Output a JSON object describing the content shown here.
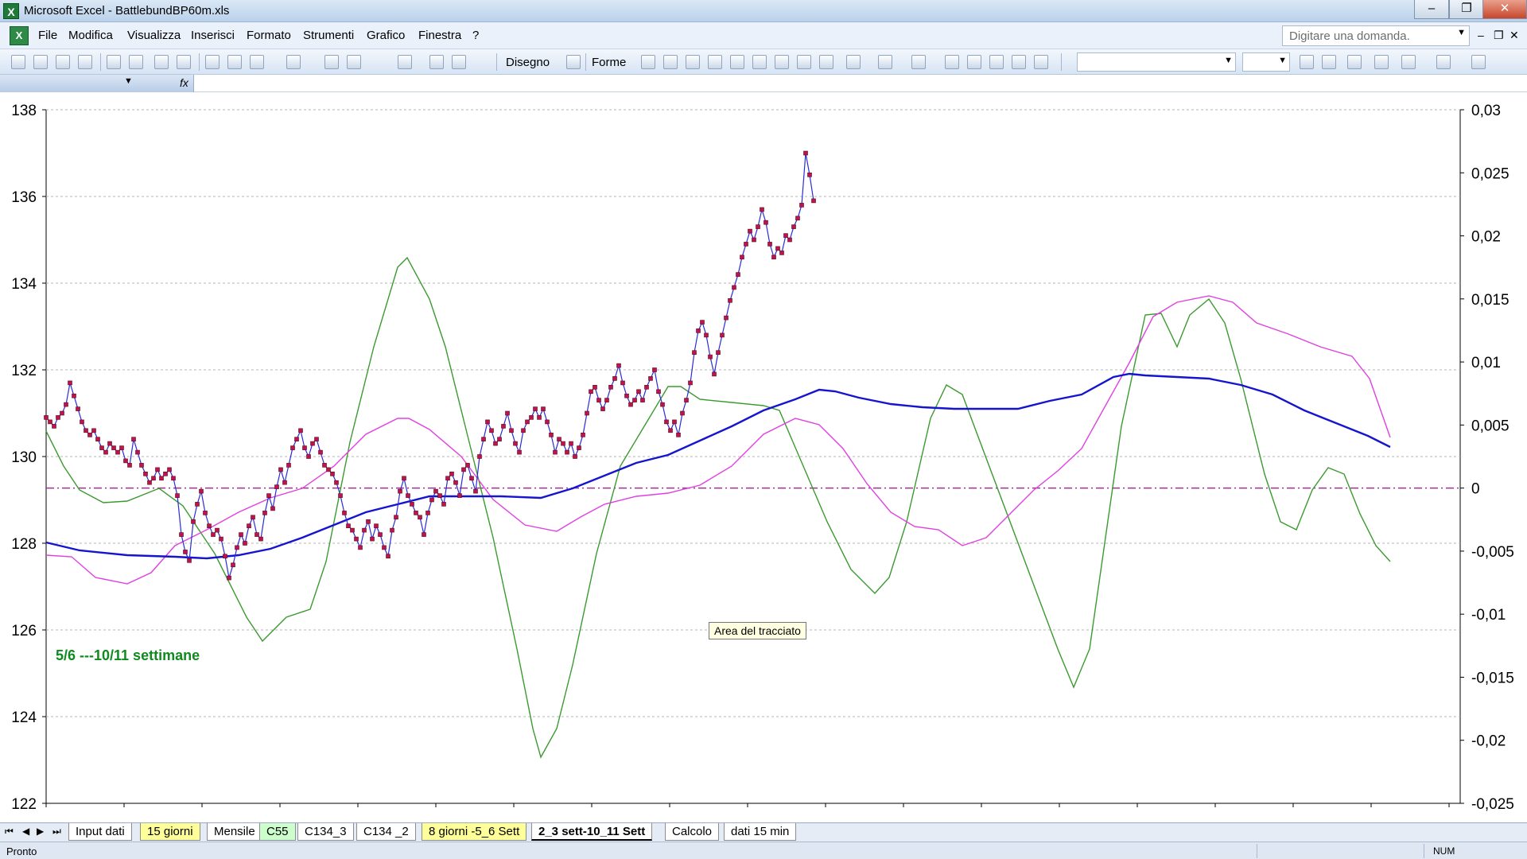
{
  "window": {
    "title": "Microsoft Excel - BattlebundBP60m.xls"
  },
  "menu": {
    "items": [
      "File",
      "Modifica",
      "Visualizza",
      "Inserisci",
      "Formato",
      "Strumenti",
      "Grafico",
      "Finestra",
      "?"
    ],
    "help_placeholder": "Digitare una domanda."
  },
  "toolbar": {
    "draw_label": "Disegno",
    "shapes_label": "Forme"
  },
  "chart": {
    "annotation": "5/6 ---10/11 settimane",
    "tooltip": "Area del tracciato"
  },
  "chart_data": {
    "type": "line",
    "left_axis": {
      "ylim": [
        122,
        138
      ],
      "ticks": [
        "122",
        "124",
        "126",
        "128",
        "130",
        "132",
        "134",
        "136",
        "138"
      ]
    },
    "right_axis": {
      "ylim": [
        -0.025,
        0.03
      ],
      "ticks": [
        "-0,025",
        "-0,02",
        "-0,015",
        "-0,01",
        "-0,005",
        "0",
        "0,005",
        "0,01",
        "0,015",
        "0,02",
        "0,025",
        "0,03"
      ]
    },
    "x": [
      0,
      5,
      10,
      15,
      20,
      25,
      30,
      35,
      40,
      45,
      50,
      55,
      60,
      65,
      70,
      75,
      80,
      85,
      90,
      95,
      100,
      105,
      110,
      115,
      120,
      125,
      130,
      135,
      140,
      145,
      150,
      155,
      160,
      165,
      170,
      175,
      180,
      185,
      190,
      195,
      200,
      205,
      210,
      215,
      220,
      225,
      230,
      235,
      240,
      245,
      250,
      255,
      260,
      265,
      270,
      275,
      280,
      285,
      290,
      295,
      300,
      305,
      310,
      315,
      320,
      325,
      330,
      335,
      340,
      345,
      350,
      355,
      360,
      365,
      370,
      375,
      380,
      385,
      390,
      395,
      400,
      405,
      410,
      415,
      420,
      425,
      430,
      435,
      440,
      445,
      450,
      455,
      460,
      465,
      470,
      475,
      480,
      485,
      490,
      495,
      500,
      505,
      510,
      515,
      520,
      525,
      530,
      535,
      540,
      545,
      550,
      555,
      560,
      565,
      570,
      575,
      580,
      585,
      590,
      595,
      600,
      605,
      610,
      615,
      620,
      625,
      630,
      635,
      640,
      645,
      650,
      655,
      660,
      665,
      670,
      675,
      680,
      685,
      690,
      695,
      700,
      705,
      710,
      715,
      720,
      725,
      730,
      735,
      740,
      745,
      750,
      755,
      760,
      765,
      770,
      775,
      780,
      785,
      790,
      795,
      800,
      805,
      810,
      815,
      820,
      825,
      830,
      835,
      840,
      845,
      850,
      855,
      860,
      865,
      870,
      875,
      880,
      885,
      890,
      895,
      900,
      905,
      910,
      915,
      920,
      925,
      930,
      935,
      940,
      945,
      950,
      955,
      960,
      965,
      970,
      975,
      980,
      985,
      990,
      995,
      1000,
      1005,
      1010,
      1015,
      1020,
      1025,
      1030,
      1035,
      1040,
      1045,
      1050,
      1055,
      1060,
      1065,
      1070,
      1075,
      1080,
      1085,
      1090,
      1095,
      1100,
      1105,
      1110,
      1115,
      1120,
      1125,
      1130,
      1135,
      1140,
      1145,
      1150,
      1155,
      1160,
      1165,
      1170,
      1175,
      1180,
      1185,
      1190,
      1195,
      1200,
      1205,
      1210,
      1215,
      1220,
      1225,
      1230,
      1235,
      1240,
      1245,
      1250,
      1255,
      1260,
      1265,
      1270,
      1275,
      1280,
      1285,
      1290,
      1295,
      1300,
      1305,
      1310,
      1315,
      1320,
      1325,
      1330,
      1335,
      1340,
      1345,
      1350,
      1355,
      1360,
      1365,
      1370,
      1375,
      1380
    ],
    "series": [
      {
        "axis": "left",
        "color": "#c0134a",
        "markers": true,
        "values": [
          130.9,
          130.8,
          130.7,
          130.9,
          131.0,
          131.2,
          131.7,
          131.4,
          131.1,
          130.8,
          130.6,
          130.5,
          130.6,
          130.4,
          130.2,
          130.1,
          130.3,
          130.2,
          130.1,
          130.2,
          129.9,
          129.8,
          130.4,
          130.1,
          129.8,
          129.6,
          129.4,
          129.5,
          129.7,
          129.5,
          129.6,
          129.7,
          129.5,
          129.1,
          128.2,
          127.8,
          127.6,
          128.5,
          128.9,
          129.2,
          128.7,
          128.4,
          128.2,
          128.3,
          128.1,
          127.7,
          127.2,
          127.5,
          127.9,
          128.2,
          128.0,
          128.4,
          128.6,
          128.2,
          128.1,
          128.7,
          129.1,
          128.8,
          129.3,
          129.7,
          129.4,
          129.8,
          130.2,
          130.4,
          130.6,
          130.2,
          130.0,
          130.3,
          130.4,
          130.1,
          129.8,
          129.7,
          129.6,
          129.4,
          129.1,
          128.7,
          128.4,
          128.3,
          128.1,
          127.9,
          128.3,
          128.5,
          128.1,
          128.4,
          128.2,
          127.9,
          127.7,
          128.3,
          128.6,
          129.2,
          129.5,
          129.1,
          128.9,
          128.7,
          128.6,
          128.2,
          128.7,
          129.0,
          129.2,
          129.1,
          128.9,
          129.5,
          129.6,
          129.4,
          129.1,
          129.7,
          129.8,
          129.5,
          129.2,
          130.0,
          130.4,
          130.8,
          130.6,
          130.3,
          130.4,
          130.7,
          131.0,
          130.6,
          130.3,
          130.1,
          130.6,
          130.8,
          130.9,
          131.1,
          130.9,
          131.1,
          130.8,
          130.5,
          130.1,
          130.4,
          130.3,
          130.1,
          130.3,
          130.0,
          130.2,
          130.5,
          131.0,
          131.5,
          131.6,
          131.3,
          131.1,
          131.3,
          131.6,
          131.8,
          132.1,
          131.7,
          131.4,
          131.2,
          131.3,
          131.5,
          131.3,
          131.6,
          131.8,
          132.0,
          131.5,
          131.2,
          130.8,
          130.6,
          130.8,
          130.5,
          131.0,
          131.3,
          131.7,
          132.4,
          132.9,
          133.1,
          132.8,
          132.3,
          131.9,
          132.4,
          132.8,
          133.2,
          133.6,
          133.9,
          134.2,
          134.6,
          134.9,
          135.2,
          135.0,
          135.3,
          135.7,
          135.4,
          134.9,
          134.6,
          134.8,
          134.7,
          135.1,
          135.0,
          135.3,
          135.5,
          135.8,
          137.0,
          136.5,
          135.9
        ]
      }
    ]
  }
}
